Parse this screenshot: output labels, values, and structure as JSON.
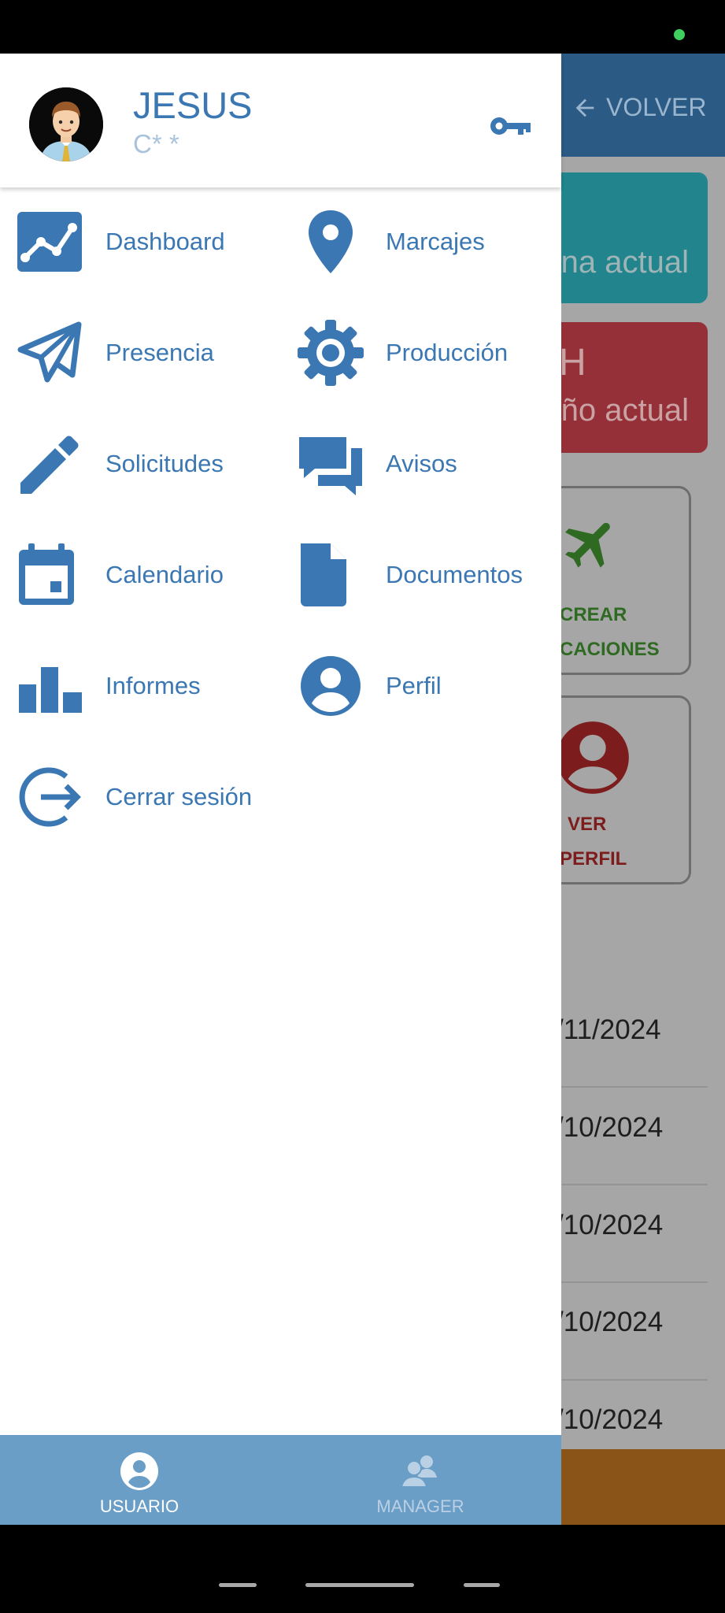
{
  "background": {
    "back_label": "VOLVER",
    "card_teal_text": "na actual",
    "card_red_title": "H",
    "card_red_text": "ño actual",
    "tile1_line1": "CREAR",
    "tile1_line2": "CACIONES",
    "tile2_line1": "VER",
    "tile2_line2": "PERFIL",
    "dates": [
      "/11/2024",
      "/10/2024",
      "/10/2024",
      "/10/2024",
      "/10/2024"
    ]
  },
  "drawer": {
    "user_name": "JESUS",
    "user_sub": "C* *",
    "menu": [
      {
        "label": "Dashboard",
        "icon": "chart-line-icon"
      },
      {
        "label": "Marcajes",
        "icon": "map-pin-icon"
      },
      {
        "label": "Presencia",
        "icon": "paper-plane-icon"
      },
      {
        "label": "Producción",
        "icon": "gear-icon"
      },
      {
        "label": "Solicitudes",
        "icon": "pencil-icon"
      },
      {
        "label": "Avisos",
        "icon": "chat-bubbles-icon"
      },
      {
        "label": "Calendario",
        "icon": "calendar-icon"
      },
      {
        "label": "Documentos",
        "icon": "document-icon"
      },
      {
        "label": "Informes",
        "icon": "bar-chart-icon"
      },
      {
        "label": "Perfil",
        "icon": "user-circle-icon"
      },
      {
        "label": "Cerrar sesión",
        "icon": "logout-icon"
      }
    ],
    "tabs": {
      "user": "USUARIO",
      "manager": "MANAGER"
    }
  },
  "colors": {
    "accent": "#3a77b3",
    "tabbar": "#6b9ec6"
  }
}
